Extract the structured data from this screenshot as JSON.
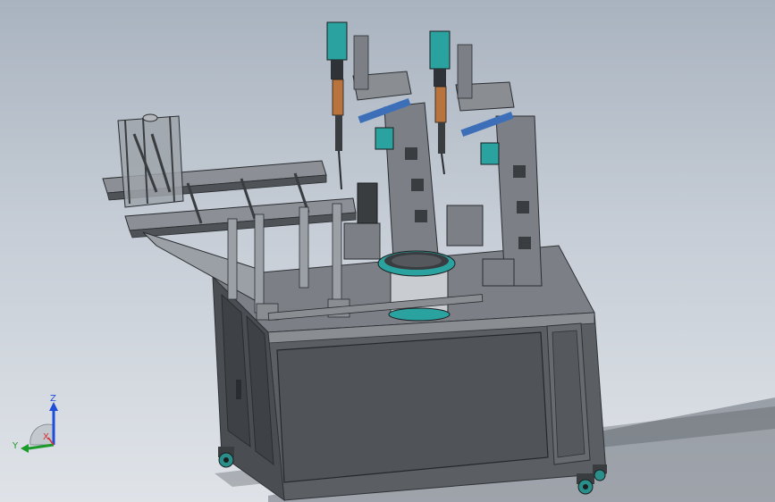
{
  "viewport": {
    "background_top": "#a9b3bf",
    "background_bottom": "#dfe3e8"
  },
  "triad": {
    "z_label": "Z",
    "y_label": "Y",
    "x_label": "X",
    "z_color": "#1f4fd8",
    "y_color": "#1a9a2a",
    "x_color": "#d83030"
  },
  "colors": {
    "frame": "#6e7276",
    "panel": "#55595d",
    "teal": "#2aa3a0",
    "copper": "#b8743c",
    "aluminium": "#9aa0a6",
    "dark": "#2f3236"
  }
}
